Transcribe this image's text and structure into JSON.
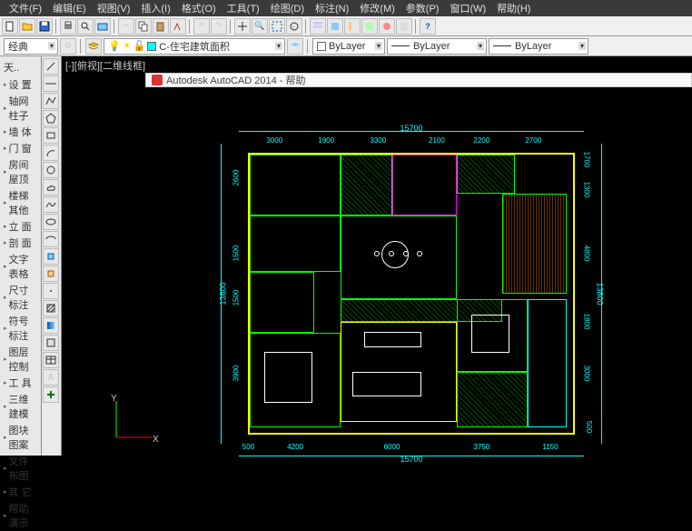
{
  "menu": {
    "file": "文件(F)",
    "edit": "编辑(E)",
    "view": "视图(V)",
    "insert": "插入(I)",
    "format": "格式(O)",
    "tools": "工具(T)",
    "draw": "绘图(D)",
    "dimension": "标注(N)",
    "modify": "修改(M)",
    "parametric": "参数(P)",
    "window": "窗口(W)",
    "help": "帮助(H)"
  },
  "toolbar2": {
    "workspace": "经典",
    "layer": "C-住宅建筑面积",
    "color": "ByLayer",
    "linetype": "ByLayer",
    "lineweight": "ByLayer"
  },
  "palette": {
    "title": "天..",
    "items": [
      "设 置",
      "轴网柱子",
      "墙 体",
      "门 窗",
      "房间屋顶",
      "楼梯其他",
      "立 面",
      "剖 面",
      "文字表格",
      "尺寸标注",
      "符号标注",
      "图层控制",
      "工 具",
      "三维建模",
      "图块图案",
      "文件布图",
      "其 它",
      "帮助演示"
    ]
  },
  "viewport": {
    "label": "[-][俯视][二维线框]"
  },
  "help_panel": {
    "title": "Autodesk AutoCAD 2014 - 帮助"
  },
  "dims": {
    "overall_w": "15700",
    "overall_h": "13800",
    "top_segs": [
      "3000",
      "1900",
      "3300",
      "2100",
      "2200",
      "2700"
    ],
    "bot_segs": [
      "500",
      "4200",
      "6000",
      "3750",
      "1150"
    ],
    "left_segs": [
      "2600",
      "1500",
      "1500",
      "3900"
    ],
    "right_segs": [
      "1700",
      "1300",
      "4800",
      "1800",
      "3000",
      "500"
    ]
  },
  "ucs": {
    "x": "X",
    "y": "Y"
  }
}
